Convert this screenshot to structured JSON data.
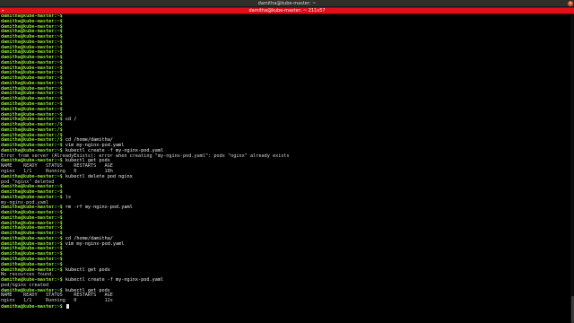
{
  "window": {
    "title": "damitha@kube-master: ~",
    "close_glyph": "×"
  },
  "tab": {
    "label": "damitha@kube-master: ~ 211x57",
    "arrow_glyph": "▸"
  },
  "terminal": {
    "prompt": "damitha@kube-master:~$",
    "lines": [
      {
        "kind": "prompt",
        "path": "~",
        "cmd": ""
      },
      {
        "kind": "prompt",
        "path": "~",
        "cmd": ""
      },
      {
        "kind": "prompt",
        "path": "~",
        "cmd": ""
      },
      {
        "kind": "prompt",
        "path": "~",
        "cmd": ""
      },
      {
        "kind": "prompt",
        "path": "~",
        "cmd": ""
      },
      {
        "kind": "prompt",
        "path": "~",
        "cmd": ""
      },
      {
        "kind": "prompt",
        "path": "~",
        "cmd": ""
      },
      {
        "kind": "prompt",
        "path": "~",
        "cmd": ""
      },
      {
        "kind": "prompt",
        "path": "~",
        "cmd": ""
      },
      {
        "kind": "prompt",
        "path": "~",
        "cmd": ""
      },
      {
        "kind": "prompt",
        "path": "~",
        "cmd": ""
      },
      {
        "kind": "prompt",
        "path": "~",
        "cmd": ""
      },
      {
        "kind": "prompt",
        "path": "~",
        "cmd": ""
      },
      {
        "kind": "prompt",
        "path": "~",
        "cmd": ""
      },
      {
        "kind": "prompt",
        "path": "~",
        "cmd": ""
      },
      {
        "kind": "prompt",
        "path": "~",
        "cmd": ""
      },
      {
        "kind": "prompt",
        "path": "~",
        "cmd": ""
      },
      {
        "kind": "prompt",
        "path": "~",
        "cmd": ""
      },
      {
        "kind": "prompt",
        "path": "~",
        "cmd": ""
      },
      {
        "kind": "prompt",
        "path": "~",
        "cmd": ""
      },
      {
        "kind": "prompt",
        "path": "~",
        "cmd": "cd /"
      },
      {
        "kind": "prompt",
        "path": "/",
        "cmd": ""
      },
      {
        "kind": "prompt",
        "path": "/",
        "cmd": ""
      },
      {
        "kind": "prompt",
        "path": "/",
        "cmd": ""
      },
      {
        "kind": "prompt",
        "path": "/",
        "cmd": "cd /home/damitha/"
      },
      {
        "kind": "prompt",
        "path": "~",
        "cmd": "vim my-nginx-pod.yaml"
      },
      {
        "kind": "prompt",
        "path": "~",
        "cmd": "kubectl create -f my-nginx-pod.yaml"
      },
      {
        "kind": "output",
        "text": "Error from server (AlreadyExists): error when creating \"my-nginx-pod.yaml\": pods \"nginx\" already exists"
      },
      {
        "kind": "prompt",
        "path": "~",
        "cmd": "kubectl get pods"
      },
      {
        "kind": "output",
        "text": "NAME    READY   STATUS    RESTARTS   AGE"
      },
      {
        "kind": "output",
        "text": "nginx   1/1     Running   0          18h"
      },
      {
        "kind": "prompt",
        "path": "~",
        "cmd": "kubectl delete pod nginx"
      },
      {
        "kind": "output",
        "text": "pod \"nginx\" deleted"
      },
      {
        "kind": "prompt",
        "path": "~",
        "cmd": ""
      },
      {
        "kind": "prompt",
        "path": "~",
        "cmd": ""
      },
      {
        "kind": "prompt",
        "path": "~",
        "cmd": "ls"
      },
      {
        "kind": "output",
        "text": "my-nginx-pod.yaml"
      },
      {
        "kind": "prompt",
        "path": "~",
        "cmd": "rm -rf my-nginx-pod.yaml"
      },
      {
        "kind": "prompt",
        "path": "~",
        "cmd": ""
      },
      {
        "kind": "prompt",
        "path": "~",
        "cmd": ""
      },
      {
        "kind": "prompt",
        "path": "~",
        "cmd": ""
      },
      {
        "kind": "prompt",
        "path": "~",
        "cmd": ""
      },
      {
        "kind": "prompt",
        "path": "~",
        "cmd": ""
      },
      {
        "kind": "prompt",
        "path": "~",
        "cmd": "cd /home/damitha/"
      },
      {
        "kind": "prompt",
        "path": "~",
        "cmd": "vim my-nginx-pod.yaml"
      },
      {
        "kind": "prompt",
        "path": "~",
        "cmd": ""
      },
      {
        "kind": "prompt",
        "path": "~",
        "cmd": ""
      },
      {
        "kind": "prompt",
        "path": "~",
        "cmd": ""
      },
      {
        "kind": "prompt",
        "path": "~",
        "cmd": ""
      },
      {
        "kind": "prompt",
        "path": "~",
        "cmd": "kubectl get pods"
      },
      {
        "kind": "output",
        "text": "No resources found."
      },
      {
        "kind": "prompt",
        "path": "~",
        "cmd": "kubectl create -f my-nginx-pod.yaml"
      },
      {
        "kind": "output",
        "text": "pod/nginx created"
      },
      {
        "kind": "prompt",
        "path": "~",
        "cmd": "kubectl get pods"
      },
      {
        "kind": "output",
        "text": "NAME    READY   STATUS    RESTARTS   AGE"
      },
      {
        "kind": "output",
        "text": "nginx   1/1     Running   0          12s"
      },
      {
        "kind": "prompt",
        "path": "~",
        "cmd": "",
        "cursor": true
      }
    ]
  },
  "colors": {
    "prompt": "#8ae234",
    "tab_bar": "#e0101a",
    "background": "#000000"
  }
}
